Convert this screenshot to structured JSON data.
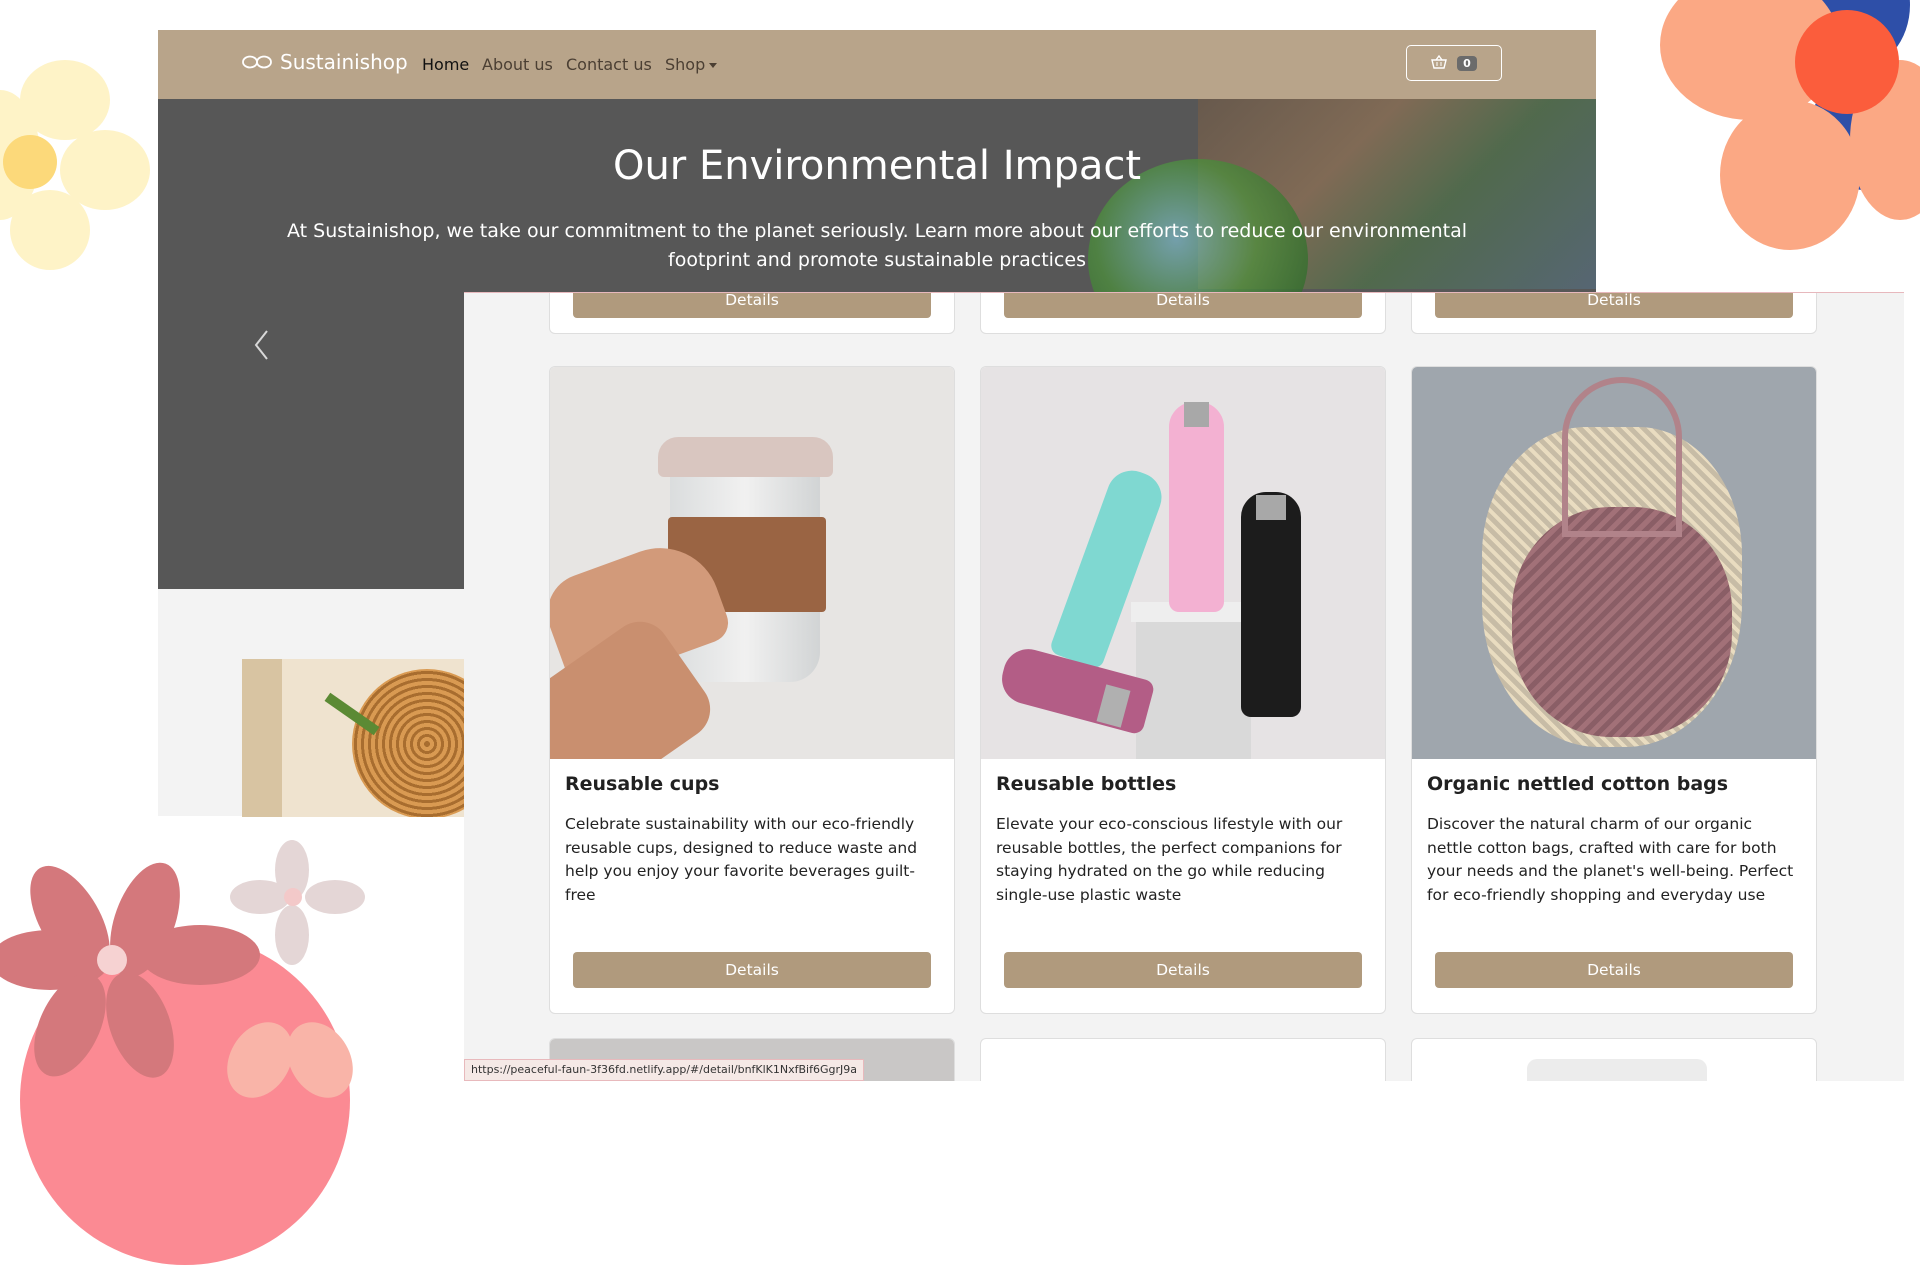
{
  "colors": {
    "navbar": "#b8a48a",
    "button": "#b09a7d",
    "hero_overlay": "#575757",
    "page_bg": "#f3f3f3"
  },
  "navbar": {
    "brand": "Sustainishop",
    "brand_icon": "infinity-leaf-icon",
    "links": [
      "Home",
      "About us",
      "Contact us",
      "Shop"
    ],
    "active_link": "Home",
    "cart_icon": "basket-icon",
    "cart_count": "0"
  },
  "hero": {
    "title": "Our Environmental Impact",
    "text": "At Sustainishop, we take our commitment to the planet seriously. Learn more about our efforts to reduce our environmental footprint and promote sustainable practices",
    "prev_icon": "chevron-left-icon"
  },
  "products": {
    "details_label": "Details",
    "cards": [
      {
        "title": "Reusable cups",
        "description": "Celebrate sustainability with our eco-friendly reusable cups, designed to reduce waste and help you enjoy your favorite beverages guilt-free"
      },
      {
        "title": "Reusable bottles",
        "description": "Elevate your eco-conscious lifestyle with our reusable bottles, the perfect companions for staying hydrated on the go while reducing single-use plastic waste"
      },
      {
        "title": "Organic nettled cotton bags",
        "description": "Discover the natural charm of our organic nettle cotton bags, crafted with care for both your needs and the planet's well-being. Perfect for eco-friendly shopping and everyday use"
      }
    ]
  },
  "status_bar": {
    "url": "https://peaceful-faun-3f36fd.netlify.app/#/detail/bnfKlK1NxfBif6GgrJ9a"
  }
}
